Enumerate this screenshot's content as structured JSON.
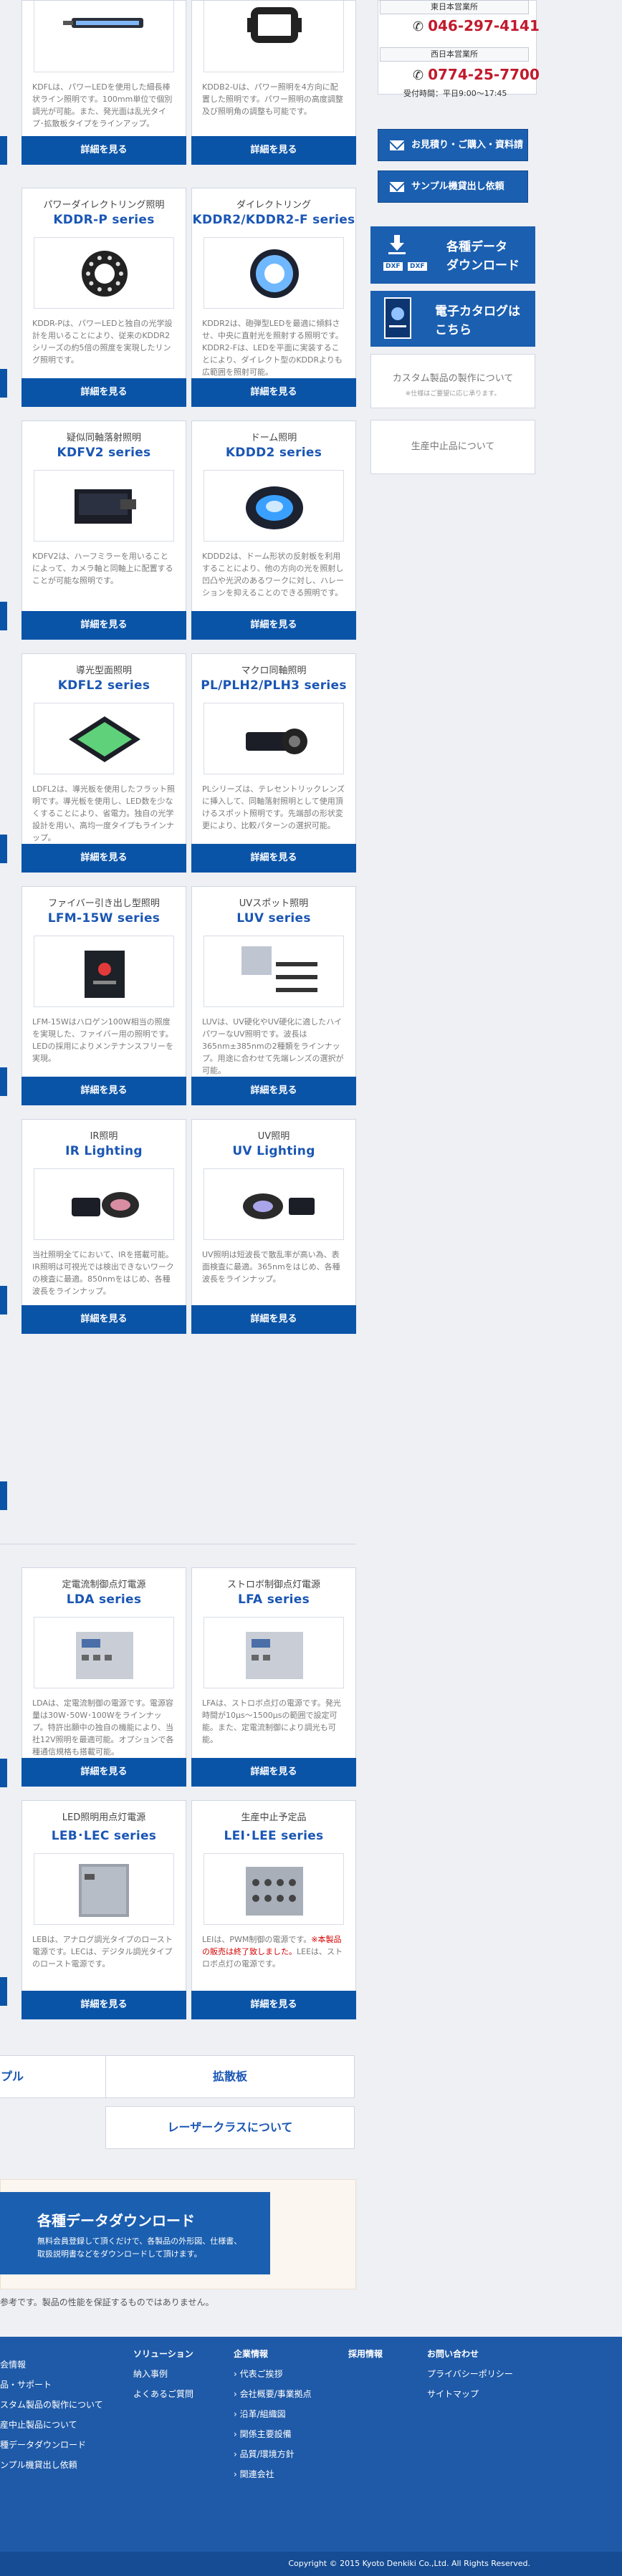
{
  "sidebar": {
    "offices": [
      {
        "label": "東日本営業所",
        "tel": "046-297-4141"
      },
      {
        "label": "西日本営業所",
        "tel": "0774-25-7700",
        "hours": "受付時間：平日9:00〜17:45"
      }
    ],
    "estimate_button": "お見積り・ご購入・資料請求",
    "sample_button": "サンプル機貸出し依頼",
    "download_button": {
      "line1": "各種データ",
      "line2": "ダウンロード",
      "badge1": "DXF",
      "badge2": "DXF"
    },
    "catalog_button": {
      "line1": "電子カタログは",
      "line2": "こちら"
    },
    "custom_box": {
      "title": "カスタム製品の製作について",
      "note": "※仕様はご要望に応じ承ります。"
    },
    "discontinued_box": "生産中止品について"
  },
  "top_cards": [
    {
      "desc": "KDFLは、パワーLEDを使用した細長棒状ライン照明です。100mm単位で個別調光が可能。また、発光面は乱光タイプ･拡散板タイプをラインアップ。",
      "button": "詳細を見る"
    },
    {
      "desc": "KDDB2-Uは、パワー照明を4方向に配置した照明です。パワー照明の高度調整及び照明角の調整も可能です。",
      "button": "詳細を見る"
    }
  ],
  "cards": [
    {
      "category": "パワーダイレクトリング照明",
      "name": "KDDR-P series",
      "desc": "KDDR-Pは、パワーLEDと独自の光学設計を用いることにより、従来のKDDR2シリーズの約5倍の照度を実現したリング照明です。",
      "button": "詳細を見る"
    },
    {
      "category": "ダイレクトリング",
      "name": "KDDR2/KDDR2-F series",
      "desc": "KDDR2は、砲弾型LEDを最適に傾斜させ、中央に直射光を照射する照明です。KDDR2-Fは、LEDを平面に実装することにより、ダイレクト型のKDDRよりも広範囲を照射可能。",
      "button": "詳細を見る"
    },
    {
      "category": "疑似同軸落射照明",
      "name": "KDFV2 series",
      "desc": "KDFV2は、ハーフミラーを用いることによって、カメラ軸と同軸上に配置することが可能な照明です。",
      "button": "詳細を見る"
    },
    {
      "category": "ドーム照明",
      "name": "KDDD2 series",
      "desc": "KDDD2は、ドーム形状の反射板を利用することにより、他の方向の光を照射し凹凸や光沢のあるワークに対し、ハレーションを抑えることのできる照明です。",
      "button": "詳細を見る"
    },
    {
      "category": "導光型面照明",
      "name": "KDFL2 series",
      "desc": "LDFL2は、導光板を使用したフラット照明です。導光板を使用し、LED数を少なくすることにより、省電力。独自の光学設計を用い、高均一度タイプもラインナップ。",
      "button": "詳細を見る"
    },
    {
      "category": "マクロ同軸照明",
      "name": "PL/PLH2/PLH3 series",
      "desc": "PLシリーズは、テレセントリックレンズに挿入して、同軸落射照明として使用頂けるスポット照明です。先端部の形状変更により、比較パターンの選択可能。",
      "button": "詳細を見る"
    },
    {
      "category": "ファイバー引き出し型照明",
      "name": "LFM-15W series",
      "desc": "LFM-15Wはハロゲン100W相当の照度を実現した、ファイバー用の照明です。LEDの採用によりメンテナンスフリーを実現。",
      "button": "詳細を見る"
    },
    {
      "category": "UVスポット照明",
      "name": "LUV series",
      "desc": "LUVは、UV硬化やUV硬化に適したハイパワーなUV照明です。波長は365nm±385nmの2種類をラインナップ。用途に合わせて先端レンズの選択が可能。",
      "button": "詳細を見る"
    },
    {
      "category": "IR照明",
      "name": "IR Lighting",
      "desc": "当社照明全てにおいて、IRを搭載可能。IR照明は可視光では検出できないワークの検査に最適。850nmをはじめ、各種波長をラインナップ。",
      "button": "詳細を見る"
    },
    {
      "category": "UV照明",
      "name": "UV Lighting",
      "desc": "UV照明は短波長で散乱率が高い為、表面検査に最適。365nmをはじめ、各種波長をラインナップ。",
      "button": "詳細を見る"
    },
    {
      "category": "定電流制御点灯電源",
      "name": "LDA series",
      "desc": "LDAは、定電流制御の電源です。電源容量は30W･50W･100Wをラインナップ。特許出願中の独自の機能により、当社12V照明を最適可能。オプションで各種通信規格も搭載可能。",
      "button": "詳細を見る"
    },
    {
      "category": "ストロボ制御点灯電源",
      "name": "LFA series",
      "desc": "LFAは、ストロボ点灯の電源です。発光時間が10μs〜1500μsの範囲で設定可能。また、定電流制御により調光も可能。",
      "button": "詳細を見る"
    },
    {
      "category": "LED照明用点灯電源",
      "name": "LEB･LEC series",
      "desc": "LEBは、アナログ調光タイプのロースト電源です。LECは、デジタル調光タイプのロースト電源です。",
      "button": "詳細を見る"
    },
    {
      "category": "生産中止予定品",
      "name": "LEI･LEE series",
      "desc_pre": "LEIは、PWM制御の電源です。",
      "desc_red": "※本製品の販売は終了致しました。",
      "desc_post": "LEEは、ストロボ点灯の電源です。",
      "button": "詳細を見る"
    }
  ],
  "bottom_links": {
    "left_partial": "プル",
    "diffuser": "拡散板",
    "laser": "レーザークラスについて"
  },
  "download_banner": {
    "title": "各種データダウンロード",
    "text1": "無料会員登録して頂くだけで、各製品の外形図、仕様書、",
    "text2": "取扱説明書などをダウンロードして頂けます。"
  },
  "disclaimer": "参考です。製品の性能を保証するものではありません。",
  "footer": {
    "col1": [
      "会情報",
      "品・サポート",
      "スタム製品の製作について",
      "産中止製品について",
      "種データダウンロード",
      "ンプル機貸出し依頼"
    ],
    "col2": [
      "ソリューション",
      "納入事例",
      "よくあるご質問"
    ],
    "col3_head": "企業情報",
    "col3": [
      "代表ご挨拶",
      "会社概要/事業拠点",
      "沿革/組織図",
      "関係主要設備",
      "品質/環境方針",
      "関連会社"
    ],
    "col4_head": "採用情報",
    "col5": [
      "お問い合わせ",
      "プライバシーポリシー",
      "サイトマップ"
    ],
    "copyright": "Copyright © 2015 Kyoto Denkiki Co.,Ltd. All Rights Reserved."
  },
  "colors": {
    "accent": "#0a54a8",
    "brand_text": "#1a56b4",
    "tel_red": "#c11a2c",
    "footer": "#1f5aa8"
  }
}
